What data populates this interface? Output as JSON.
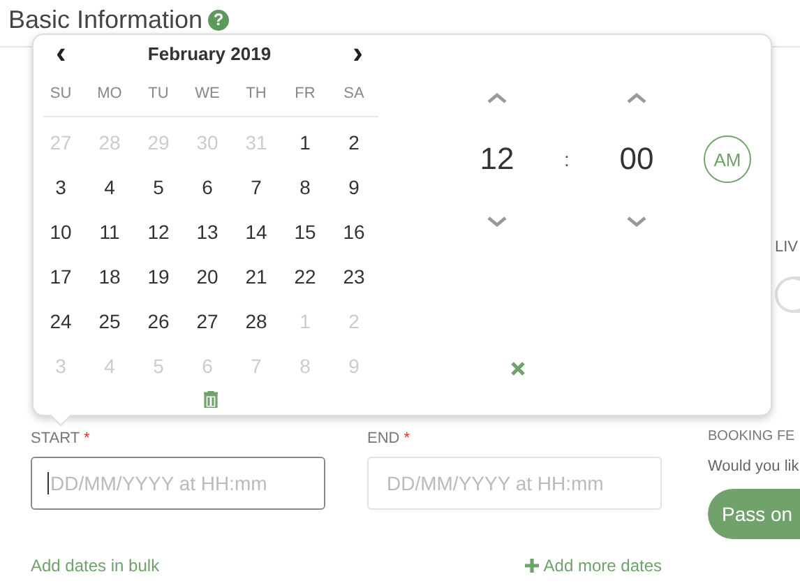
{
  "page_title": "Basic Information",
  "help": "?",
  "calendar": {
    "month": "February 2019",
    "prev": "‹",
    "next": "›",
    "weekdays": [
      "SU",
      "MO",
      "TU",
      "WE",
      "TH",
      "FR",
      "SA"
    ],
    "days": [
      {
        "label": "27",
        "in_month": false
      },
      {
        "label": "28",
        "in_month": false
      },
      {
        "label": "29",
        "in_month": false
      },
      {
        "label": "30",
        "in_month": false
      },
      {
        "label": "31",
        "in_month": false
      },
      {
        "label": "1",
        "in_month": true
      },
      {
        "label": "2",
        "in_month": true
      },
      {
        "label": "3",
        "in_month": true
      },
      {
        "label": "4",
        "in_month": true
      },
      {
        "label": "5",
        "in_month": true
      },
      {
        "label": "6",
        "in_month": true
      },
      {
        "label": "7",
        "in_month": true
      },
      {
        "label": "8",
        "in_month": true
      },
      {
        "label": "9",
        "in_month": true
      },
      {
        "label": "10",
        "in_month": true
      },
      {
        "label": "11",
        "in_month": true
      },
      {
        "label": "12",
        "in_month": true
      },
      {
        "label": "13",
        "in_month": true
      },
      {
        "label": "14",
        "in_month": true
      },
      {
        "label": "15",
        "in_month": true
      },
      {
        "label": "16",
        "in_month": true
      },
      {
        "label": "17",
        "in_month": true
      },
      {
        "label": "18",
        "in_month": true
      },
      {
        "label": "19",
        "in_month": true
      },
      {
        "label": "20",
        "in_month": true
      },
      {
        "label": "21",
        "in_month": true
      },
      {
        "label": "22",
        "in_month": true
      },
      {
        "label": "23",
        "in_month": true
      },
      {
        "label": "24",
        "in_month": true
      },
      {
        "label": "25",
        "in_month": true
      },
      {
        "label": "26",
        "in_month": true
      },
      {
        "label": "27",
        "in_month": true
      },
      {
        "label": "28",
        "in_month": true
      },
      {
        "label": "1",
        "in_month": false
      },
      {
        "label": "2",
        "in_month": false
      },
      {
        "label": "3",
        "in_month": false
      },
      {
        "label": "4",
        "in_month": false
      },
      {
        "label": "5",
        "in_month": false
      },
      {
        "label": "6",
        "in_month": false
      },
      {
        "label": "7",
        "in_month": false
      },
      {
        "label": "8",
        "in_month": false
      },
      {
        "label": "9",
        "in_month": false
      }
    ]
  },
  "time": {
    "hour": "12",
    "separator": ":",
    "minute": "00",
    "period": "AM"
  },
  "side_label": "LIV",
  "toggle": {
    "on": false
  },
  "fields": [
    {
      "label": "START",
      "required_mark": "*",
      "placeholder": "DD/MM/YYYY at HH:mm",
      "focused": true
    },
    {
      "label": "END",
      "required_mark": "*",
      "placeholder": "DD/MM/YYYY at HH:mm",
      "focused": false
    }
  ],
  "booking_fee_label": "BOOKING FE",
  "question": "Would you lik",
  "pass_button": "Pass on",
  "links": {
    "bulk": "Add dates in bulk",
    "more": "Add more dates"
  }
}
